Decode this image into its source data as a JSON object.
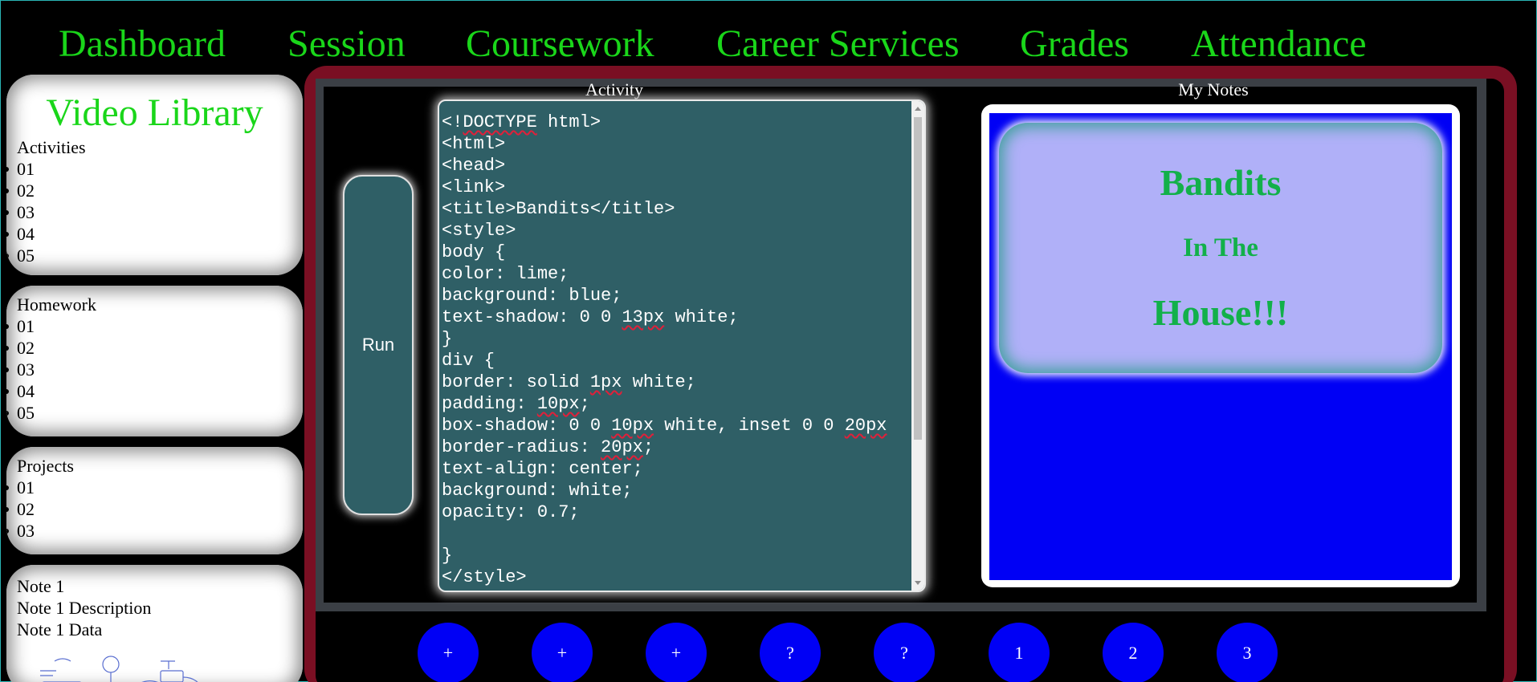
{
  "nav": {
    "items": [
      "Dashboard",
      "Session",
      "Coursework",
      "Career Services",
      "Grades",
      "Attendance"
    ]
  },
  "sidebar": {
    "video_library_title": "Video Library",
    "activities": {
      "heading": "Activities",
      "items": [
        "01",
        "02",
        "03",
        "04",
        "05"
      ]
    },
    "homework": {
      "heading": "Homework",
      "items": [
        "01",
        "02",
        "03",
        "04",
        "05"
      ]
    },
    "projects": {
      "heading": "Projects",
      "items": [
        "01",
        "02",
        "03"
      ]
    },
    "notes": {
      "title": "Note 1",
      "description": "Note 1 Description",
      "data": "Note 1 Data"
    }
  },
  "main": {
    "activity_label": "Activity",
    "notes_label": "My Notes",
    "run_label": "Run",
    "code_lines": [
      "<!DOCTYPE html>",
      "<html>",
      "<head>",
      "<link>",
      "<title>Bandits</title>",
      "<style>",
      "body {",
      "color: lime;",
      "background: blue;",
      "text-shadow: 0 0 13px white;",
      "}",
      "div {",
      "border: solid 1px white;",
      "padding: 10px;",
      "box-shadow: 0 0 10px white, inset 0 0 20px",
      "border-radius: 20px;",
      "text-align: center;",
      "background: white;",
      "opacity: 0.7;",
      "",
      "}",
      "</style>"
    ],
    "spellcheck_words": [
      "DOCTYPE",
      "13px",
      "1px",
      "10px",
      "20px"
    ],
    "preview": {
      "line1": "Bandits",
      "line2": "In The",
      "line3": "House!!!"
    }
  },
  "bottom_buttons": [
    "+",
    "+",
    "+",
    "?",
    "?",
    "1",
    "2",
    "3"
  ],
  "colors": {
    "nav_text": "#1ad61a",
    "frame": "#7a0f23",
    "editor_bg": "#2f5f66",
    "notes_bg": "#0000f5",
    "preview_text": "#12b04a",
    "button_blue": "#0000f5"
  }
}
